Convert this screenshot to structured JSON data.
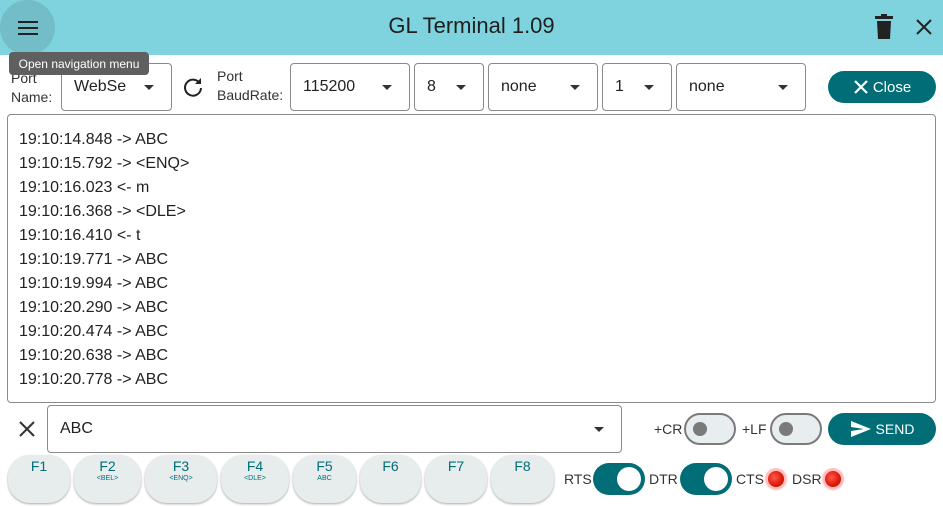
{
  "appbar": {
    "title": "GL Terminal 1.09",
    "tooltip": "Open navigation menu",
    "icons": {
      "menu": "menu-icon",
      "trash": "trash-icon",
      "close": "close-icon"
    }
  },
  "port": {
    "name_label": "Port Name:",
    "name_value": "WebSe",
    "baud_label": "Port BaudRate:",
    "baud_value": "115200",
    "data_bits": "8",
    "parity": "none",
    "stop_bits": "1",
    "flow_control": "none",
    "close_label": "Close"
  },
  "log": {
    "lines": [
      "19:10:14.848 -> ABC",
      "19:10:15.792 -> <ENQ>",
      "19:10:16.023 <- m",
      "19:10:16.368 -> <DLE>",
      "19:10:16.410 <- t",
      "19:10:19.771 -> ABC",
      "19:10:19.994 -> ABC",
      "19:10:20.290 -> ABC",
      "19:10:20.474 -> ABC",
      "19:10:20.638 -> ABC",
      "19:10:20.778 -> ABC"
    ]
  },
  "send": {
    "value": "ABC",
    "cr_label": "+CR",
    "lf_label": "+LF",
    "send_label": "SEND",
    "cr_on": false,
    "lf_on": false
  },
  "fkeys": [
    {
      "name": "F1",
      "sub": ""
    },
    {
      "name": "F2",
      "sub": "<BEL>"
    },
    {
      "name": "F3",
      "sub": "<ENQ>"
    },
    {
      "name": "F4",
      "sub": "<DLE>"
    },
    {
      "name": "F5",
      "sub": "ABC"
    },
    {
      "name": "F6",
      "sub": ""
    },
    {
      "name": "F7",
      "sub": ""
    },
    {
      "name": "F8",
      "sub": ""
    }
  ],
  "signals": {
    "rts_label": "RTS",
    "dtr_label": "DTR",
    "cts_label": "CTS",
    "dsr_label": "DSR",
    "rts_on": true,
    "dtr_on": true
  },
  "colors": {
    "appbar": "#7fd3de",
    "accent": "#006d77",
    "led": "#e01b0b"
  }
}
